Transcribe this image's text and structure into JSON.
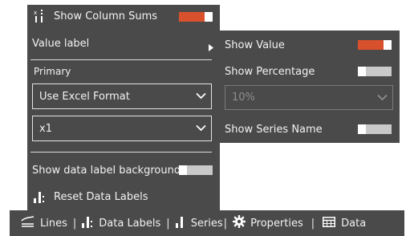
{
  "menu": {
    "show_column_sums": {
      "label": "Show Column Sums",
      "icon": "column-sums-icon",
      "state": "on"
    },
    "value_label": {
      "label": "Value label"
    },
    "primary_heading": "Primary",
    "format_select": {
      "value": "Use Excel Format"
    },
    "scale_select": {
      "value": "x1"
    },
    "show_bg": {
      "label": "Show data label background",
      "state": "off"
    },
    "reset": {
      "label": "Reset Data Labels",
      "icon": "reset-labels-icon"
    }
  },
  "submenu": {
    "show_value": {
      "label": "Show Value",
      "state": "on"
    },
    "show_percentage": {
      "label": "Show Percentage",
      "state": "off"
    },
    "percent_select": {
      "value": "10%"
    },
    "show_series_name": {
      "label": "Show Series Name",
      "state": "off"
    }
  },
  "toolbar": {
    "items": [
      {
        "label": "Lines",
        "icon": "lines-icon"
      },
      {
        "label": "Data Labels",
        "icon": "data-labels-icon"
      },
      {
        "label": "Series",
        "icon": "series-icon"
      },
      {
        "label": "Properties",
        "icon": "gear-icon"
      },
      {
        "label": "Data",
        "icon": "table-icon"
      }
    ]
  },
  "colors": {
    "panel": "#4a4a4a",
    "toggle_on": "#d9512c",
    "toggle_off": "#c9c9c9"
  }
}
